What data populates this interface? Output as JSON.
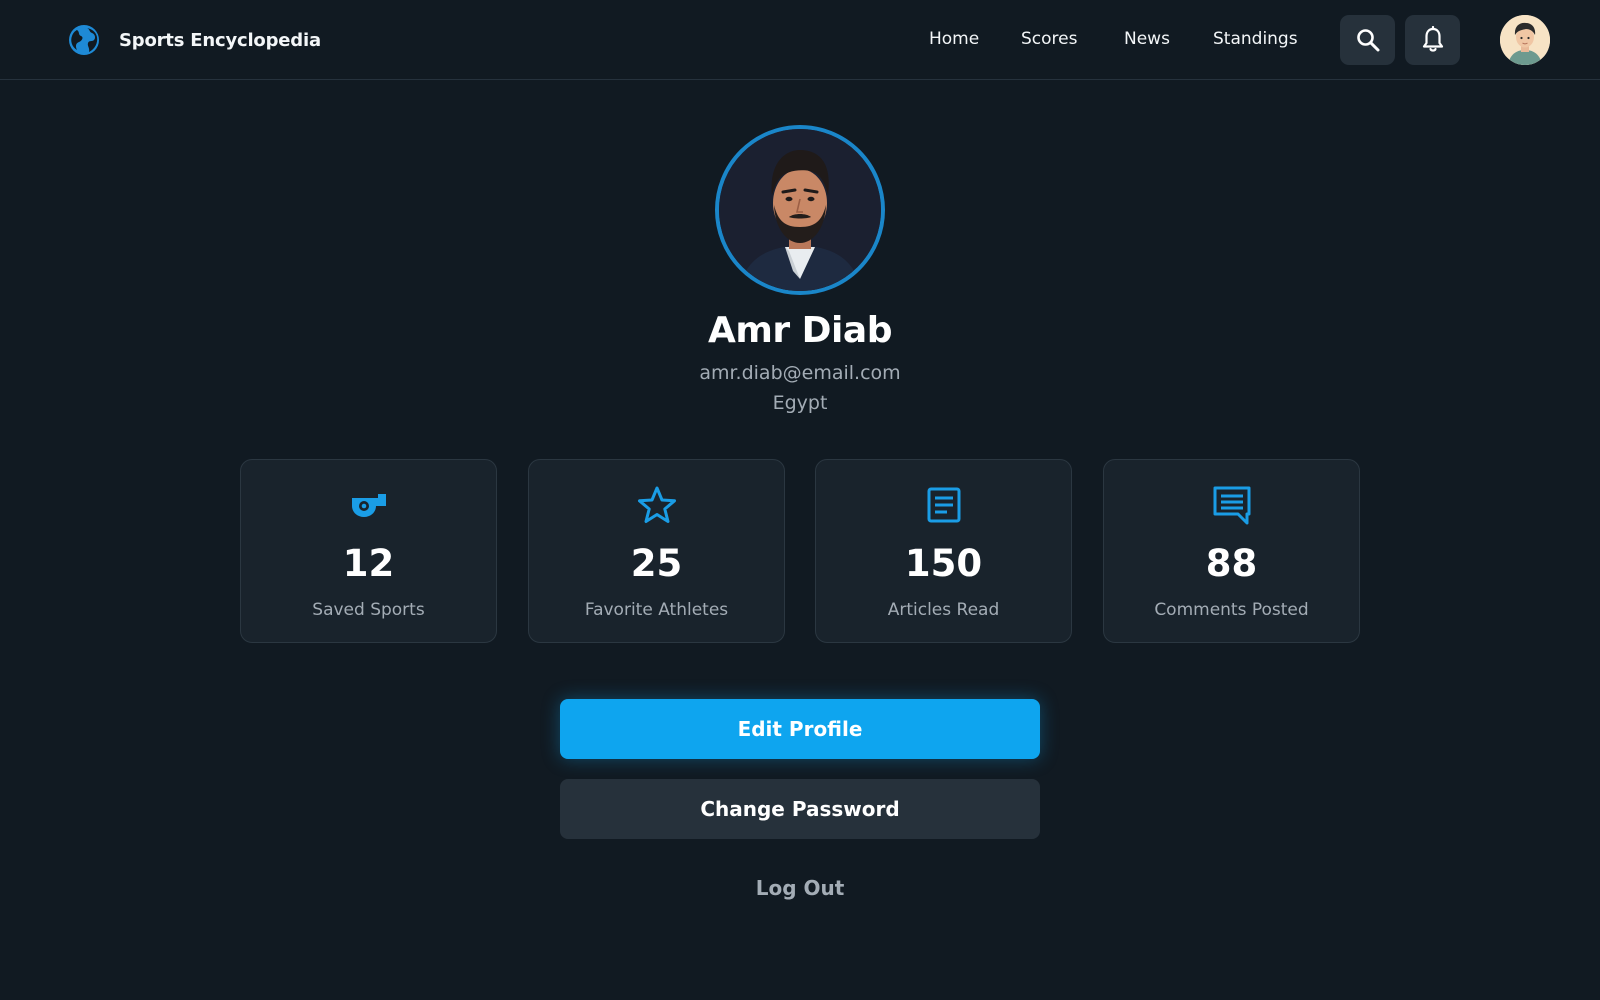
{
  "app": {
    "title": "Sports Encyclopedia",
    "logo_icon": "globe-icon",
    "accent_color": "#0ea5ef"
  },
  "nav": {
    "links": [
      "Home",
      "Scores",
      "News",
      "Standings"
    ],
    "search_icon": "search-icon",
    "notifications_icon": "bell-icon"
  },
  "user": {
    "name": "Amr Diab",
    "email": "amr.diab@email.com",
    "country": "Egypt"
  },
  "stats": [
    {
      "icon": "whistle-icon",
      "value": "12",
      "label": "Saved Sports"
    },
    {
      "icon": "star-icon",
      "value": "25",
      "label": "Favorite Athletes"
    },
    {
      "icon": "article-icon",
      "value": "150",
      "label": "Articles Read"
    },
    {
      "icon": "comment-icon",
      "value": "88",
      "label": "Comments Posted"
    }
  ],
  "actions": {
    "edit_profile": "Edit Profile",
    "change_password": "Change Password",
    "log_out": "Log Out"
  }
}
